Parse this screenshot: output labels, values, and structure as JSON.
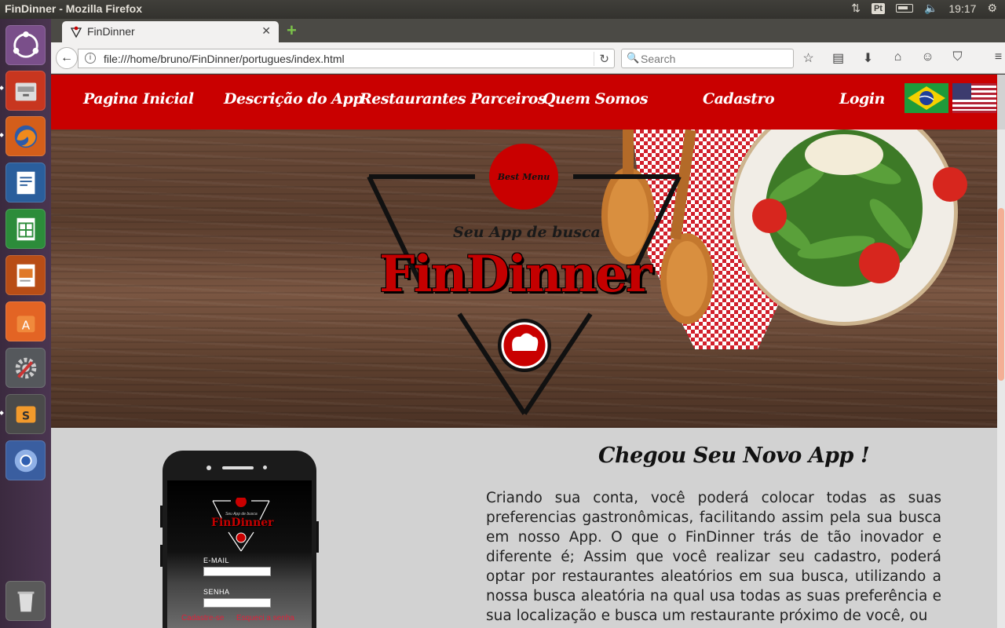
{
  "os": {
    "window_title": "FinDinner - Mozilla Firefox",
    "keyboard_layout": "Pt",
    "clock": "19:17"
  },
  "browser": {
    "tab_title": "FinDinner",
    "url": "file:///home/bruno/FinDinner/portugues/index.html",
    "search_placeholder": "Search"
  },
  "site": {
    "nav": [
      {
        "label": "Pagina Inicial"
      },
      {
        "label": "Descrição do App"
      },
      {
        "label": "Restaurantes Parceiros"
      },
      {
        "label": "Quem Somos"
      },
      {
        "label": "Cadastro"
      },
      {
        "label": "Login"
      }
    ],
    "flags": [
      "brazil-flag",
      "usa-flag"
    ],
    "hero": {
      "badge": "Best Menu",
      "tagline": "Seu App de busca",
      "brand": "FinDinner"
    },
    "section": {
      "heading": "Chegou Seu Novo App !",
      "paragraph": "Criando sua conta, você poderá colocar todas as suas preferencias gastronômicas, facilitando assim pela sua busca em nosso App. O que o FinDinner trás de tão inovador e diferente é; Assim que você realizar seu cadastro, poderá optar por restaurantes aleatórios em sua busca, utilizando a nossa busca aleatória na qual usa todas as suas preferência e sua localização e busca um restaurante próximo de você, ou"
    },
    "phone": {
      "tagline": "Seu App de busca",
      "brand": "FinDinner",
      "email_label": "E-MAIL",
      "password_label": "SENHA",
      "signup_link": "Cadastre-se",
      "forgot_link": "Esqueci a senha"
    }
  },
  "colors": {
    "nav_red": "#c90000",
    "brand_red": "#c40000",
    "page_bg": "#d2d2d2"
  }
}
